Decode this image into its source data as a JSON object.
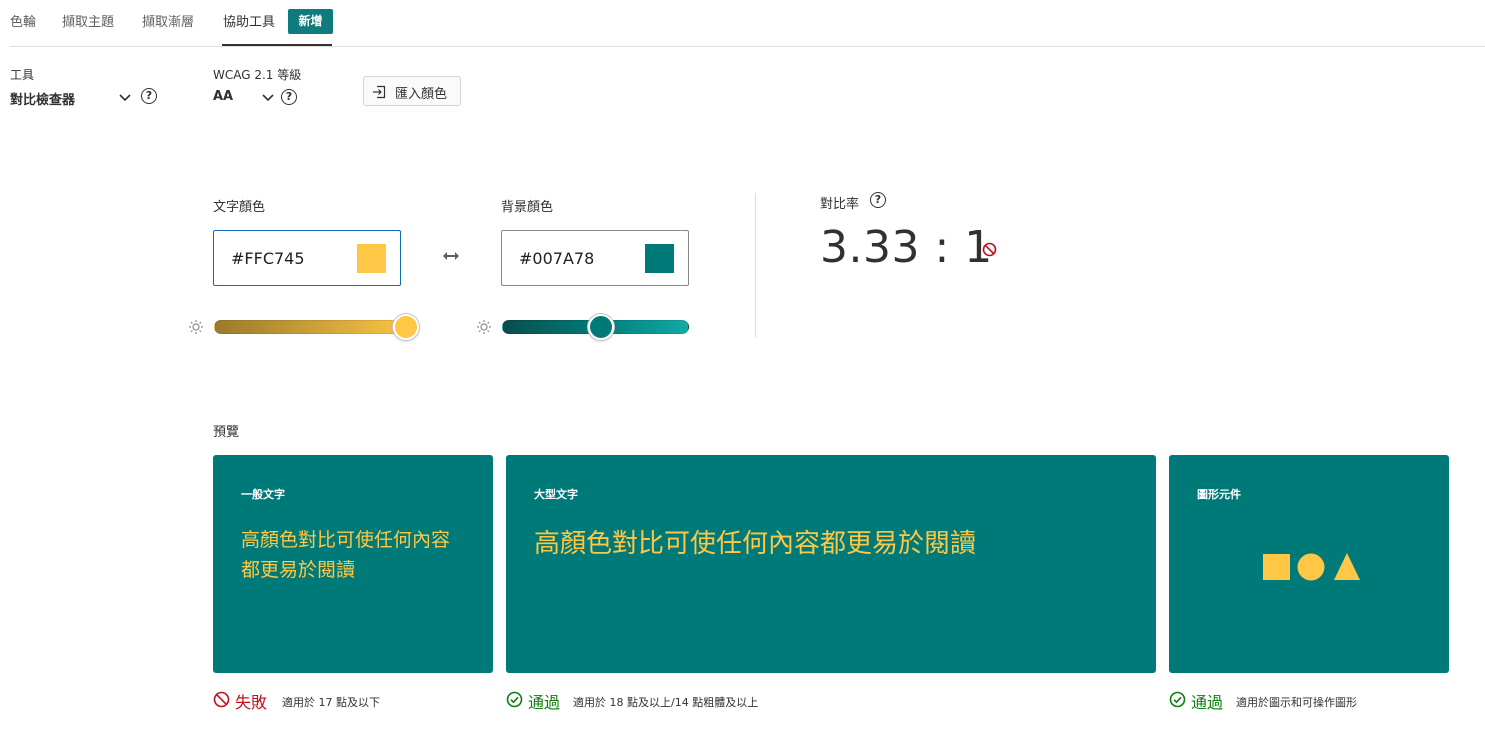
{
  "tabs": [
    {
      "label": "色輪"
    },
    {
      "label": "擷取主題"
    },
    {
      "label": "擷取漸層"
    },
    {
      "label": "協助工具"
    }
  ],
  "new_button_label": "新增",
  "tool": {
    "label": "工具",
    "value": "對比檢查器"
  },
  "wcag": {
    "label": "WCAG 2.1 等級",
    "value": "AA"
  },
  "import_button_label": "匯入顏色",
  "text_color": {
    "label": "文字顏色",
    "hex": "#FFC745",
    "slider_level": 0.94
  },
  "background_color": {
    "label": "背景顏色",
    "hex": "#007A78",
    "slider_level": 0.53
  },
  "contrast": {
    "label": "對比率",
    "ratio": "3.33 : 1"
  },
  "preview": {
    "label": "預覽",
    "cards": [
      {
        "title": "一般文字",
        "text": "高顏色對比可使任何內容都更易於閱讀"
      },
      {
        "title": "大型文字",
        "text": "高顏色對比可使任何內容都更易於閱讀"
      },
      {
        "title": "圖形元件"
      }
    ],
    "results": [
      {
        "status": "失敗",
        "desc": "適用於 17 點及以下",
        "status_color": "#c50f1f"
      },
      {
        "status": "通過",
        "desc": "適用於 18 點及以上/14 點粗體及以上",
        "status_color": "#107c10"
      },
      {
        "status": "通過",
        "desc": "適用於圖示和可操作圖形",
        "status_color": "#107c10"
      }
    ]
  },
  "colors": {
    "accent": "#0f7b7c",
    "text_color": "#ffc745",
    "background_color": "#007a78",
    "fail": "#c50f1f",
    "pass": "#107c10"
  },
  "icons": [
    "help-icon",
    "chevron-down-icon",
    "import-icon",
    "swap-icon",
    "brightness-icon",
    "blocked-icon",
    "check-circle-icon"
  ]
}
